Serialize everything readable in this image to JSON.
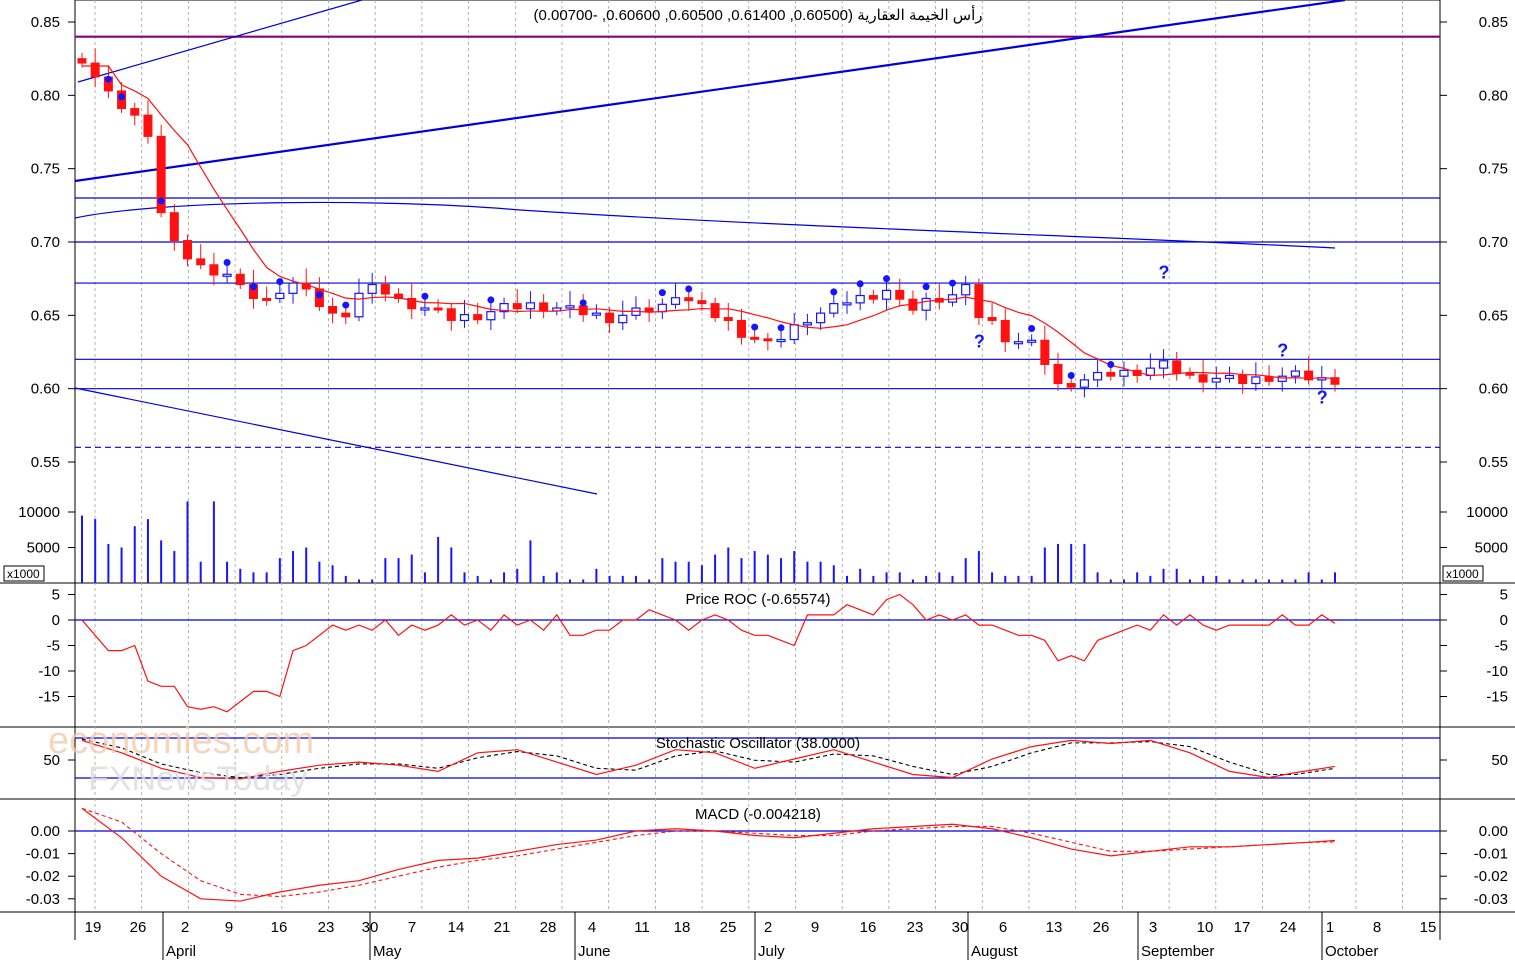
{
  "colors": {
    "bull": "#1515ff",
    "bear": "#ff1111",
    "line_blue": "#0000dd",
    "line_red": "#ff1111",
    "purple": "#800080",
    "grid": "#a0a0a0"
  },
  "chart_data": [
    {
      "type": "candlestick",
      "panel": "price",
      "title": "رأس الخيمة العقارية (0.60500, 0.61400, 0.60500, 0.60600, -0.00700)",
      "ylim": [
        0.525,
        0.865
      ],
      "y_ticks": [
        0.85,
        0.8,
        0.75,
        0.7,
        0.65,
        0.6,
        0.55
      ],
      "y_tick_labels": [
        "0.85",
        "0.80",
        "0.75",
        "0.70",
        "0.65",
        "0.60",
        "0.55"
      ],
      "horizontal_lines": [
        0.84,
        0.73,
        0.7,
        0.672,
        0.62,
        0.6
      ],
      "dashed_line": 0.56,
      "close_anchors": [
        [
          0,
          0.825
        ],
        [
          2,
          0.8
        ],
        [
          4,
          0.785
        ],
        [
          5,
          0.775
        ],
        [
          6,
          0.72
        ],
        [
          7,
          0.698
        ],
        [
          8,
          0.69
        ],
        [
          9,
          0.683
        ],
        [
          11,
          0.678
        ],
        [
          12,
          0.668
        ],
        [
          13,
          0.663
        ],
        [
          14,
          0.66
        ],
        [
          15,
          0.668
        ],
        [
          16,
          0.672
        ],
        [
          17,
          0.665
        ],
        [
          19,
          0.65
        ],
        [
          20,
          0.652
        ],
        [
          21,
          0.665
        ],
        [
          22,
          0.668
        ],
        [
          23,
          0.666
        ],
        [
          24,
          0.66
        ],
        [
          26,
          0.655
        ],
        [
          28,
          0.648
        ],
        [
          30,
          0.65
        ],
        [
          32,
          0.655
        ],
        [
          34,
          0.657
        ],
        [
          36,
          0.655
        ],
        [
          38,
          0.652
        ],
        [
          40,
          0.648
        ],
        [
          42,
          0.652
        ],
        [
          44,
          0.656
        ],
        [
          45,
          0.665
        ],
        [
          46,
          0.66
        ],
        [
          47,
          0.655
        ],
        [
          49,
          0.645
        ],
        [
          50,
          0.638
        ],
        [
          52,
          0.63
        ],
        [
          53,
          0.635
        ],
        [
          54,
          0.642
        ],
        [
          55,
          0.648
        ],
        [
          57,
          0.655
        ],
        [
          58,
          0.66
        ],
        [
          60,
          0.664
        ],
        [
          61,
          0.667
        ],
        [
          62,
          0.658
        ],
        [
          63,
          0.655
        ],
        [
          64,
          0.66
        ],
        [
          66,
          0.664
        ],
        [
          67,
          0.668
        ],
        [
          68,
          0.65
        ],
        [
          69,
          0.645
        ],
        [
          70,
          0.635
        ],
        [
          71,
          0.632
        ],
        [
          72,
          0.63
        ],
        [
          73,
          0.618
        ],
        [
          74,
          0.602
        ],
        [
          76,
          0.606
        ],
        [
          78,
          0.61
        ],
        [
          80,
          0.612
        ],
        [
          82,
          0.616
        ],
        [
          83,
          0.612
        ],
        [
          84,
          0.608
        ],
        [
          86,
          0.607
        ],
        [
          88,
          0.605
        ],
        [
          90,
          0.608
        ],
        [
          92,
          0.609
        ],
        [
          94,
          0.606
        ],
        [
          95,
          0.606
        ]
      ],
      "dot_closes_idx": [
        2,
        3,
        6,
        11,
        13,
        15,
        18,
        20,
        26,
        31,
        38,
        44,
        46,
        51,
        53,
        57,
        59,
        61,
        64,
        66,
        72,
        75,
        78
      ]
    },
    {
      "type": "bar",
      "panel": "volume",
      "ylim": [
        0,
        12500
      ],
      "y_ticks": [
        10000,
        5000
      ],
      "y_tick_labels": [
        "10000",
        "5000"
      ],
      "multiplier_label": "x1000",
      "values_note": "daily volume in thousands",
      "values": [
        9500,
        9000,
        5500,
        5000,
        8000,
        9000,
        6000,
        4500,
        11500,
        3000,
        11500,
        3000,
        2000,
        1500,
        1500,
        3500,
        4500,
        5000,
        3000,
        2500,
        1000,
        500,
        500,
        3500,
        3500,
        4000,
        1500,
        6500,
        5000,
        1500,
        1000,
        500,
        1500,
        2000,
        6000,
        1000,
        1500,
        500,
        500,
        2000,
        1000,
        1000,
        1000,
        500,
        3500,
        3000,
        3000,
        2500,
        4000,
        5000,
        3500,
        4500,
        4000,
        3500,
        4500,
        3000,
        3000,
        2500,
        1000,
        2000,
        1000,
        1500,
        1500,
        500,
        1000,
        1500,
        1000,
        3500,
        4500,
        1500,
        1000,
        1000,
        1000,
        5000,
        5500,
        5500,
        5500,
        1500,
        500,
        500,
        1500,
        1000,
        2000,
        2000,
        500,
        1000,
        1000,
        500,
        500,
        500,
        500,
        500,
        500,
        1500,
        500,
        1500
      ],
      "max_value_labels": [
        "10000",
        "5000"
      ]
    },
    {
      "type": "line",
      "panel": "roc",
      "title": "Price ROC (-0.65574)",
      "ylim": [
        -21,
        6
      ],
      "y_ticks": [
        5,
        0,
        -5,
        -10,
        -15
      ],
      "y_tick_labels": [
        "5",
        "0",
        "-5",
        "-10",
        "-15"
      ],
      "anchors": [
        [
          0,
          0
        ],
        [
          1,
          -3
        ],
        [
          2,
          -6
        ],
        [
          3,
          -6
        ],
        [
          4,
          -5
        ],
        [
          5,
          -12
        ],
        [
          6,
          -13
        ],
        [
          7,
          -13
        ],
        [
          8,
          -17
        ],
        [
          9,
          -17.5
        ],
        [
          10,
          -17
        ],
        [
          11,
          -18
        ],
        [
          12,
          -16
        ],
        [
          13,
          -14
        ],
        [
          14,
          -14
        ],
        [
          15,
          -15
        ],
        [
          16,
          -6
        ],
        [
          17,
          -5
        ],
        [
          18,
          -3
        ],
        [
          19,
          -1
        ],
        [
          20,
          -2
        ],
        [
          21,
          -1
        ],
        [
          22,
          -2
        ],
        [
          23,
          0
        ],
        [
          24,
          -3
        ],
        [
          25,
          -1
        ],
        [
          26,
          -2
        ],
        [
          27,
          -1
        ],
        [
          28,
          1
        ],
        [
          29,
          -1
        ],
        [
          30,
          0
        ],
        [
          31,
          -2
        ],
        [
          32,
          1
        ],
        [
          33,
          -1
        ],
        [
          34,
          0
        ],
        [
          35,
          -2
        ],
        [
          36,
          1
        ],
        [
          37,
          -3
        ],
        [
          38,
          -3
        ],
        [
          39,
          -2
        ],
        [
          40,
          -2
        ],
        [
          41,
          0
        ],
        [
          42,
          0
        ],
        [
          43,
          2
        ],
        [
          44,
          1
        ],
        [
          45,
          0
        ],
        [
          46,
          -2
        ],
        [
          47,
          0
        ],
        [
          48,
          1
        ],
        [
          49,
          0
        ],
        [
          50,
          -2
        ],
        [
          51,
          -3
        ],
        [
          52,
          -3
        ],
        [
          53,
          -4
        ],
        [
          54,
          -5
        ],
        [
          55,
          1
        ],
        [
          56,
          1
        ],
        [
          57,
          1
        ],
        [
          58,
          3
        ],
        [
          59,
          2
        ],
        [
          60,
          1
        ],
        [
          61,
          4
        ],
        [
          62,
          5
        ],
        [
          63,
          3
        ],
        [
          64,
          0
        ],
        [
          65,
          1
        ],
        [
          66,
          0
        ],
        [
          67,
          1
        ],
        [
          68,
          -1
        ],
        [
          69,
          -1
        ],
        [
          70,
          -2
        ],
        [
          71,
          -3
        ],
        [
          72,
          -3
        ],
        [
          73,
          -4
        ],
        [
          74,
          -8
        ],
        [
          75,
          -7
        ],
        [
          76,
          -8
        ],
        [
          77,
          -4
        ],
        [
          78,
          -3
        ],
        [
          79,
          -2
        ],
        [
          80,
          -1
        ],
        [
          81,
          -2
        ],
        [
          82,
          1
        ],
        [
          83,
          -1
        ],
        [
          84,
          1
        ],
        [
          85,
          -1
        ],
        [
          86,
          -2
        ],
        [
          87,
          -1
        ],
        [
          88,
          -1
        ],
        [
          89,
          -1
        ],
        [
          90,
          -1
        ],
        [
          91,
          1
        ],
        [
          92,
          -1
        ],
        [
          93,
          -1
        ],
        [
          94,
          1
        ],
        [
          95,
          -0.65574
        ]
      ]
    },
    {
      "type": "line",
      "panel": "stochastic",
      "title": "Stochastic Oscillator (38.0000)",
      "ylim": [
        0,
        100
      ],
      "y_ticks": [
        50
      ],
      "y_tick_labels": [
        "50"
      ],
      "horizontal_lines": [
        80,
        20
      ],
      "k_anchors": [
        [
          0,
          80
        ],
        [
          3,
          60
        ],
        [
          6,
          35
        ],
        [
          9,
          20
        ],
        [
          12,
          18
        ],
        [
          15,
          30
        ],
        [
          18,
          40
        ],
        [
          21,
          45
        ],
        [
          24,
          40
        ],
        [
          27,
          30
        ],
        [
          30,
          60
        ],
        [
          33,
          65
        ],
        [
          36,
          45
        ],
        [
          39,
          25
        ],
        [
          42,
          40
        ],
        [
          45,
          65
        ],
        [
          48,
          60
        ],
        [
          51,
          35
        ],
        [
          54,
          50
        ],
        [
          57,
          65
        ],
        [
          60,
          45
        ],
        [
          63,
          25
        ],
        [
          66,
          20
        ],
        [
          69,
          50
        ],
        [
          72,
          70
        ],
        [
          75,
          80
        ],
        [
          78,
          75
        ],
        [
          81,
          80
        ],
        [
          84,
          60
        ],
        [
          87,
          30
        ],
        [
          90,
          20
        ],
        [
          92,
          28
        ],
        [
          95,
          38
        ]
      ],
      "d_anchors": [
        [
          0,
          82
        ],
        [
          3,
          68
        ],
        [
          6,
          42
        ],
        [
          9,
          28
        ],
        [
          12,
          20
        ],
        [
          15,
          25
        ],
        [
          18,
          35
        ],
        [
          21,
          42
        ],
        [
          24,
          42
        ],
        [
          27,
          35
        ],
        [
          30,
          52
        ],
        [
          33,
          62
        ],
        [
          36,
          55
        ],
        [
          39,
          35
        ],
        [
          42,
          32
        ],
        [
          45,
          55
        ],
        [
          48,
          63
        ],
        [
          51,
          48
        ],
        [
          54,
          45
        ],
        [
          57,
          58
        ],
        [
          60,
          55
        ],
        [
          63,
          38
        ],
        [
          66,
          25
        ],
        [
          69,
          38
        ],
        [
          72,
          60
        ],
        [
          75,
          76
        ],
        [
          78,
          76
        ],
        [
          81,
          78
        ],
        [
          84,
          70
        ],
        [
          87,
          45
        ],
        [
          90,
          25
        ],
        [
          92,
          25
        ],
        [
          95,
          35
        ]
      ]
    },
    {
      "type": "line",
      "panel": "macd",
      "title": "MACD (-0.004218)",
      "ylim": [
        -0.037,
        0.009
      ],
      "y_ticks": [
        0.0,
        -0.01,
        -0.02,
        -0.03
      ],
      "y_tick_labels": [
        "0.00",
        "-0.01",
        "-0.02",
        "-0.03"
      ],
      "macd_anchors": [
        [
          0,
          0.01
        ],
        [
          3,
          -0.003
        ],
        [
          6,
          -0.02
        ],
        [
          9,
          -0.03
        ],
        [
          12,
          -0.031
        ],
        [
          15,
          -0.027
        ],
        [
          18,
          -0.024
        ],
        [
          21,
          -0.022
        ],
        [
          24,
          -0.017
        ],
        [
          27,
          -0.013
        ],
        [
          30,
          -0.012
        ],
        [
          33,
          -0.009
        ],
        [
          36,
          -0.006
        ],
        [
          39,
          -0.004
        ],
        [
          42,
          0.0
        ],
        [
          45,
          0.001
        ],
        [
          48,
          0.0
        ],
        [
          51,
          -0.002
        ],
        [
          54,
          -0.003
        ],
        [
          57,
          -0.001
        ],
        [
          60,
          0.001
        ],
        [
          63,
          0.002
        ],
        [
          66,
          0.003
        ],
        [
          69,
          0.001
        ],
        [
          72,
          -0.003
        ],
        [
          75,
          -0.008
        ],
        [
          78,
          -0.011
        ],
        [
          81,
          -0.009
        ],
        [
          84,
          -0.007
        ],
        [
          87,
          -0.007
        ],
        [
          90,
          -0.006
        ],
        [
          93,
          -0.005
        ],
        [
          95,
          -0.0042
        ]
      ],
      "signal_anchors": [
        [
          0,
          0.01
        ],
        [
          3,
          0.004
        ],
        [
          6,
          -0.01
        ],
        [
          9,
          -0.022
        ],
        [
          12,
          -0.028
        ],
        [
          15,
          -0.029
        ],
        [
          18,
          -0.027
        ],
        [
          21,
          -0.024
        ],
        [
          24,
          -0.02
        ],
        [
          27,
          -0.016
        ],
        [
          30,
          -0.013
        ],
        [
          33,
          -0.011
        ],
        [
          36,
          -0.008
        ],
        [
          39,
          -0.005
        ],
        [
          42,
          -0.002
        ],
        [
          45,
          0.0
        ],
        [
          48,
          0.0
        ],
        [
          51,
          -0.001
        ],
        [
          54,
          -0.002
        ],
        [
          57,
          -0.002
        ],
        [
          60,
          0.0
        ],
        [
          63,
          0.001
        ],
        [
          66,
          0.002
        ],
        [
          69,
          0.002
        ],
        [
          72,
          -0.001
        ],
        [
          75,
          -0.005
        ],
        [
          78,
          -0.009
        ],
        [
          81,
          -0.009
        ],
        [
          84,
          -0.008
        ],
        [
          87,
          -0.007
        ],
        [
          90,
          -0.006
        ],
        [
          93,
          -0.005
        ],
        [
          95,
          -0.0048
        ]
      ]
    }
  ],
  "x_axis": {
    "day_labels": [
      "19",
      "26",
      "2",
      "9",
      "16",
      "23",
      "30",
      "7",
      "14",
      "21",
      "28",
      "4",
      "11",
      "18",
      "25",
      "2",
      "9",
      "16",
      "23",
      "30",
      "6",
      "13",
      "26",
      "3",
      "10",
      "17",
      "24",
      "1",
      "8",
      "15"
    ],
    "month_labels": [
      "April",
      "May",
      "June",
      "July",
      "August",
      "September",
      "October"
    ]
  },
  "watermark": {
    "line1": "economies.com",
    "line2": "FXNewsToday"
  }
}
